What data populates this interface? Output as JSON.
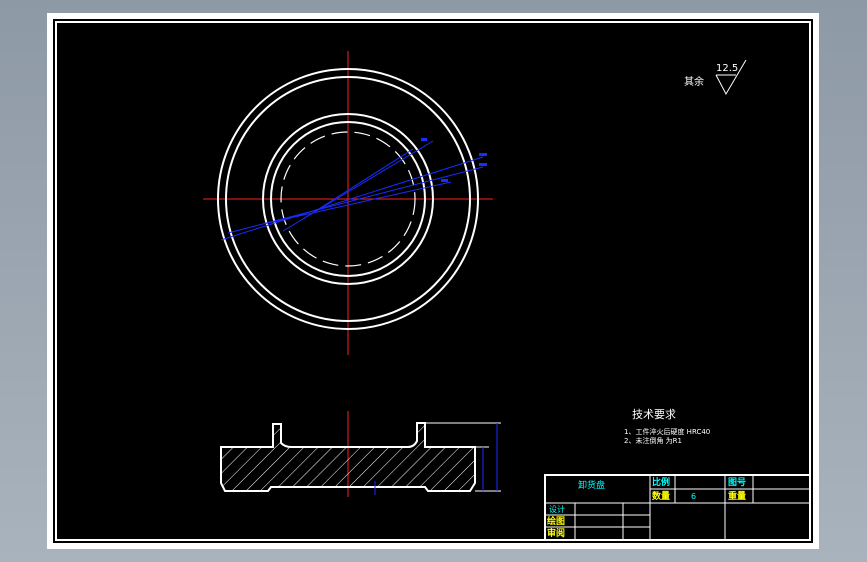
{
  "roughness": {
    "value": "12.5",
    "label": "其余"
  },
  "tech_req": {
    "title": "技术要求",
    "items": [
      "1、工件淬火后硬度 HRC40",
      "2、未注倒角 为R1"
    ]
  },
  "title_block": {
    "part_name": "卸货盘",
    "ratio_label": "比例",
    "drawing_no_label": "图号",
    "qty_label": "数量",
    "qty_value": "6",
    "weight_label": "重量",
    "design_label": "设计",
    "draw_label": "绘图",
    "review_label": "审阅"
  },
  "colors": {
    "background": "#000000",
    "outline": "#ffffff",
    "centerline": "#ff2020",
    "dimension": "#1a2cff",
    "title_text": "#00ffff",
    "label_text": "#ffff00"
  }
}
